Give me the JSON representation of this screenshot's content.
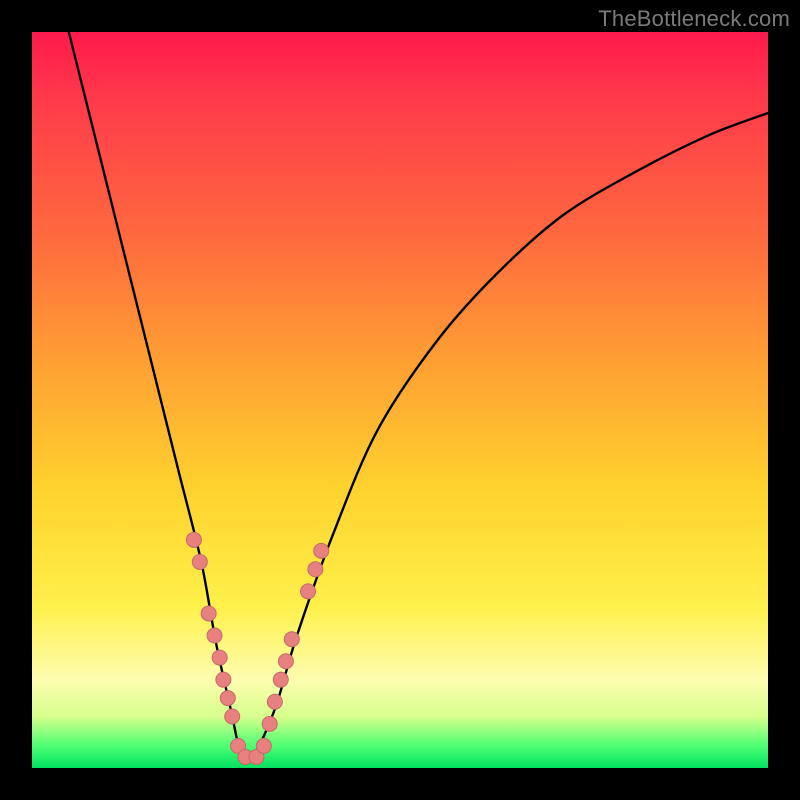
{
  "watermark": "TheBottleneck.com",
  "colors": {
    "frame": "#000000",
    "curve": "#000000",
    "dot_fill": "#e98080",
    "dot_stroke": "#c46a6a",
    "gradient_stops": [
      "#ff1a4d",
      "#ff6a3e",
      "#ffd22e",
      "#fdfdb0",
      "#00e060"
    ]
  },
  "chart_data": {
    "type": "line",
    "title": "",
    "xlabel": "",
    "ylabel": "",
    "xlim": [
      0,
      100
    ],
    "ylim": [
      0,
      100
    ],
    "series": [
      {
        "name": "bottleneck-curve",
        "x": [
          5,
          8,
          11,
          14,
          17,
          20,
          23,
          25,
          27,
          28.5,
          30,
          33,
          36,
          41,
          47,
          55,
          63,
          72,
          82,
          92,
          100
        ],
        "y": [
          100,
          88,
          76,
          64,
          52,
          40,
          28,
          17,
          8,
          1.5,
          1.5,
          8,
          18,
          32,
          46,
          58,
          67,
          75,
          81,
          86,
          89
        ]
      }
    ],
    "points": [
      {
        "name": "left-cluster",
        "x": 22.0,
        "y": 31
      },
      {
        "name": "left-cluster",
        "x": 22.8,
        "y": 28
      },
      {
        "name": "left-cluster",
        "x": 24.0,
        "y": 21
      },
      {
        "name": "left-cluster",
        "x": 24.8,
        "y": 18
      },
      {
        "name": "left-cluster",
        "x": 25.5,
        "y": 15
      },
      {
        "name": "left-cluster",
        "x": 26.0,
        "y": 12
      },
      {
        "name": "left-cluster",
        "x": 26.6,
        "y": 9.5
      },
      {
        "name": "left-cluster",
        "x": 27.2,
        "y": 7
      },
      {
        "name": "bottom",
        "x": 28.0,
        "y": 3
      },
      {
        "name": "bottom",
        "x": 29.0,
        "y": 1.5
      },
      {
        "name": "bottom",
        "x": 30.5,
        "y": 1.5
      },
      {
        "name": "bottom",
        "x": 31.5,
        "y": 3
      },
      {
        "name": "right-cluster",
        "x": 32.3,
        "y": 6
      },
      {
        "name": "right-cluster",
        "x": 33.0,
        "y": 9
      },
      {
        "name": "right-cluster",
        "x": 33.8,
        "y": 12
      },
      {
        "name": "right-cluster",
        "x": 34.5,
        "y": 14.5
      },
      {
        "name": "right-cluster",
        "x": 35.3,
        "y": 17.5
      },
      {
        "name": "right-cluster",
        "x": 37.5,
        "y": 24
      },
      {
        "name": "right-cluster",
        "x": 38.5,
        "y": 27
      },
      {
        "name": "right-cluster",
        "x": 39.3,
        "y": 29.5
      }
    ]
  }
}
